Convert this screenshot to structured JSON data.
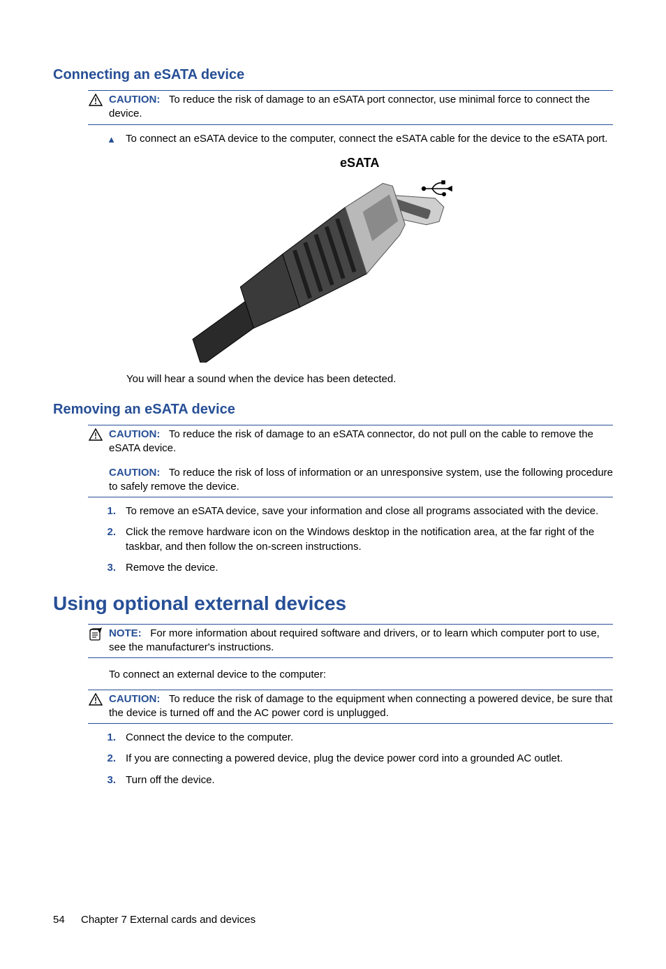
{
  "section1": {
    "heading": "Connecting an eSATA device",
    "caution_label": "CAUTION:",
    "caution_text": "To reduce the risk of damage to an eSATA port connector, use minimal force to connect the device.",
    "step_marker": "▲",
    "step_text": "To connect an eSATA device to the computer, connect the eSATA cable for the device to the eSATA port.",
    "figure_label": "eSATA",
    "post_figure": "You will hear a sound when the device has been detected."
  },
  "section2": {
    "heading": "Removing an eSATA device",
    "caution1_label": "CAUTION:",
    "caution1_text": "To reduce the risk of damage to an eSATA connector, do not pull on the cable to remove the eSATA device.",
    "caution2_label": "CAUTION:",
    "caution2_text": "To reduce the risk of loss of information or an unresponsive system, use the following procedure to safely remove the device.",
    "steps": [
      "To remove an eSATA device, save your information and close all programs associated with the device.",
      "Click the remove hardware icon on the Windows desktop in the notification area, at the far right of the taskbar, and then follow the on-screen instructions.",
      "Remove the device."
    ],
    "markers": [
      "1.",
      "2.",
      "3."
    ]
  },
  "section3": {
    "heading": "Using optional external devices",
    "note_label": "NOTE:",
    "note_text": "For more information about required software and drivers, or to learn which computer port to use, see the manufacturer's instructions.",
    "intro": "To connect an external device to the computer:",
    "caution_label": "CAUTION:",
    "caution_text": "To reduce the risk of damage to the equipment when connecting a powered device, be sure that the device is turned off and the AC power cord is unplugged.",
    "steps": [
      "Connect the device to the computer.",
      "If you are connecting a powered device, plug the device power cord into a grounded AC outlet.",
      "Turn off the device."
    ],
    "markers": [
      "1.",
      "2.",
      "3."
    ]
  },
  "footer": {
    "page": "54",
    "chapter": "Chapter 7   External cards and devices"
  }
}
